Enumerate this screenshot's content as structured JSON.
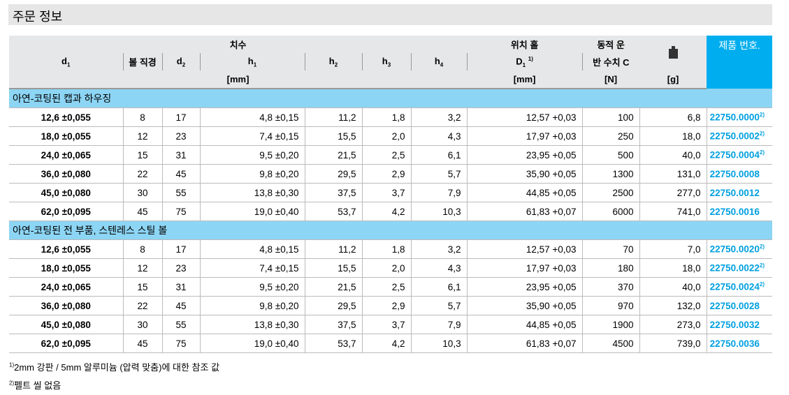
{
  "title": "주문 정보",
  "header": {
    "dims": "치수",
    "d1": "d",
    "d1_sub": "1",
    "ball": "볼 직경",
    "d2": "d",
    "d2_sub": "2",
    "h1": "h",
    "h1_sub": "1",
    "h2": "h",
    "h2_sub": "2",
    "h3": "h",
    "h3_sub": "3",
    "h4": "h",
    "h4_sub": "4",
    "pos_hole": "위치 홀",
    "D1": "D",
    "D1_sub": "1",
    "D1_sup": "1)",
    "load1": "동적 운",
    "load2": "반 수치 C",
    "unit_mm": "[mm]",
    "unit_mm2": "[mm]",
    "unit_N": "[N]",
    "unit_g": "[g]",
    "product": "제품 번호.",
    "weight_icon": "weight-icon"
  },
  "sections": [
    {
      "title": "아연-코팅된 캡과 하우징",
      "rows": [
        [
          "12,6 ±0,055",
          "8",
          "17",
          "4,8 ±0,15",
          "11,2",
          "1,8",
          "3,2",
          "12,57 +0,03",
          "100",
          "6,8",
          "22750.0000",
          "2)"
        ],
        [
          "18,0 ±0,055",
          "12",
          "23",
          "7,4 ±0,15",
          "15,5",
          "2,0",
          "4,3",
          "17,97 +0,03",
          "250",
          "18,0",
          "22750.0002",
          "2)"
        ],
        [
          "24,0 ±0,065",
          "15",
          "31",
          "9,5 ±0,20",
          "21,5",
          "2,5",
          "6,1",
          "23,95 +0,05",
          "500",
          "40,0",
          "22750.0004",
          "2)"
        ],
        [
          "36,0 ±0,080",
          "22",
          "45",
          "9,8 ±0,20",
          "29,5",
          "2,9",
          "5,7",
          "35,90 +0,05",
          "1300",
          "131,0",
          "22750.0008",
          ""
        ],
        [
          "45,0 ±0,080",
          "30",
          "55",
          "13,8 ±0,30",
          "37,5",
          "3,7",
          "7,9",
          "44,85 +0,05",
          "2500",
          "277,0",
          "22750.0012",
          ""
        ],
        [
          "62,0 ±0,095",
          "45",
          "75",
          "19,0 ±0,40",
          "53,7",
          "4,2",
          "10,3",
          "61,83 +0,07",
          "6000",
          "741,0",
          "22750.0016",
          ""
        ]
      ]
    },
    {
      "title": "아연-코팅된 전 부품, 스텐레스 스틸 볼",
      "rows": [
        [
          "12,6 ±0,055",
          "8",
          "17",
          "4,8 ±0,15",
          "11,2",
          "1,8",
          "3,2",
          "12,57 +0,03",
          "70",
          "7,0",
          "22750.0020",
          "2)"
        ],
        [
          "18,0 ±0,055",
          "12",
          "23",
          "7,4 ±0,15",
          "15,5",
          "2,0",
          "4,3",
          "17,97 +0,03",
          "180",
          "18,0",
          "22750.0022",
          "2)"
        ],
        [
          "24,0 ±0,065",
          "15",
          "31",
          "9,5 ±0,20",
          "21,5",
          "2,5",
          "6,1",
          "23,95 +0,05",
          "370",
          "40,0",
          "22750.0024",
          "2)"
        ],
        [
          "36,0 ±0,080",
          "22",
          "45",
          "9,8 ±0,20",
          "29,5",
          "2,9",
          "5,7",
          "35,90 +0,05",
          "970",
          "132,0",
          "22750.0028",
          ""
        ],
        [
          "45,0 ±0,080",
          "30",
          "55",
          "13,8 ±0,30",
          "37,5",
          "3,7",
          "7,9",
          "44,85 +0,05",
          "1900",
          "273,0",
          "22750.0032",
          ""
        ],
        [
          "62,0 ±0,095",
          "45",
          "75",
          "19,0 ±0,40",
          "53,7",
          "4,2",
          "10,3",
          "61,83 +0,07",
          "4500",
          "739,0",
          "22750.0036",
          ""
        ]
      ]
    }
  ],
  "footnotes": [
    {
      "mark": "1)",
      "text": "2mm 강판 / 5mm 알루미늄 (압력 맞춤)에 대한 참조 값"
    },
    {
      "mark": "2)",
      "text": "펠트 씰 없음"
    }
  ]
}
